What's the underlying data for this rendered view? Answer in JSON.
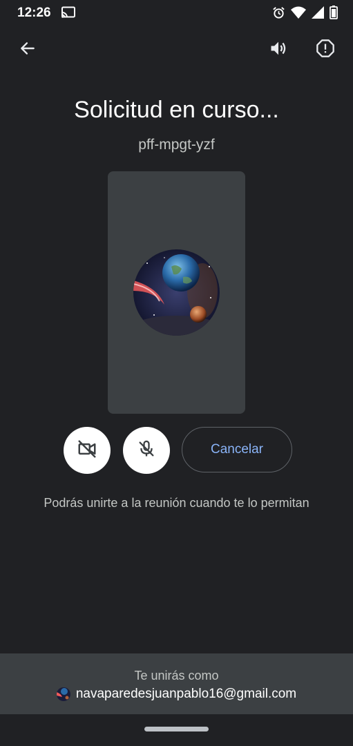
{
  "status_bar": {
    "time": "12:26",
    "icons": [
      "cast-icon",
      "alarm-icon",
      "wifi-icon",
      "signal-icon",
      "battery-icon"
    ]
  },
  "topbar": {
    "icons": [
      "back-arrow-icon",
      "speaker-icon",
      "report-icon"
    ]
  },
  "meeting": {
    "title": "Solicitud en curso...",
    "code": "pff-mpgt-yzf"
  },
  "controls": {
    "camera_icon": "video-off-icon",
    "mic_icon": "mic-off-icon",
    "cancel_label": "Cancelar"
  },
  "info_text": "Podrás unirte a la reunión cuando te lo permitan",
  "footer": {
    "label": "Te unirás como",
    "email": "navaparedesjuanpablo16@gmail.com"
  },
  "colors": {
    "background": "#202124",
    "panel": "#3c4043",
    "accent": "#8ab4f8"
  }
}
